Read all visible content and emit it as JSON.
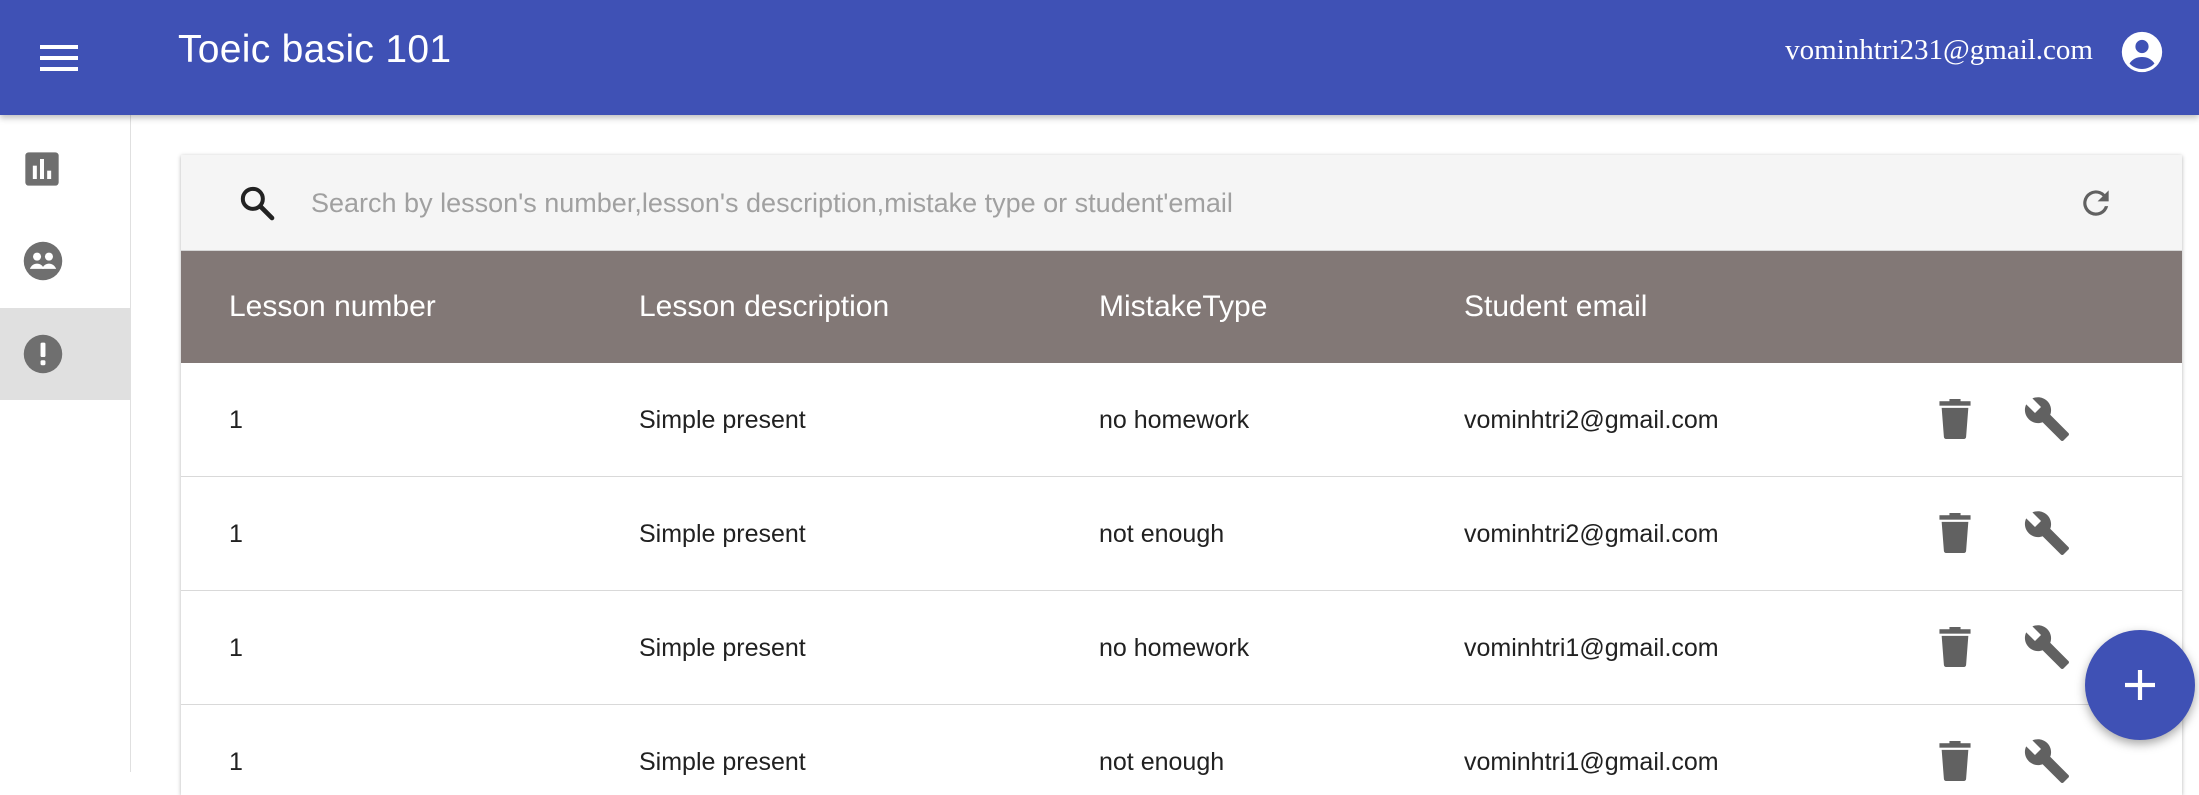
{
  "appbar": {
    "title": "Toeic basic 101",
    "user_email": "vominhtri231@gmail.com",
    "menu_icon": "menu-icon",
    "account_icon": "account-circle-icon",
    "color": "#3f51b5"
  },
  "sidebar": {
    "items": [
      {
        "icon": "bar-chart-icon",
        "active": false
      },
      {
        "icon": "people-icon",
        "active": false
      },
      {
        "icon": "error-icon",
        "active": true
      }
    ]
  },
  "search": {
    "placeholder": "Search by lesson's number,lesson's description,mistake type or student'email",
    "value": "",
    "icon": "search-icon",
    "refresh_icon": "refresh-icon"
  },
  "table": {
    "header_color": "#827876",
    "columns": [
      "Lesson number",
      "Lesson description",
      "MistakeType",
      "Student email"
    ],
    "rows": [
      {
        "lesson_number": "1",
        "lesson_description": "Simple present",
        "mistake_type": "no homework",
        "student_email": "vominhtri2@gmail.com"
      },
      {
        "lesson_number": "1",
        "lesson_description": "Simple present",
        "mistake_type": "not enough",
        "student_email": "vominhtri2@gmail.com"
      },
      {
        "lesson_number": "1",
        "lesson_description": "Simple present",
        "mistake_type": "no homework",
        "student_email": "vominhtri1@gmail.com"
      },
      {
        "lesson_number": "1",
        "lesson_description": "Simple present",
        "mistake_type": "not enough",
        "student_email": "vominhtri1@gmail.com"
      }
    ],
    "row_actions": [
      "delete-icon",
      "wrench-icon"
    ]
  },
  "fab": {
    "icon": "add-icon"
  }
}
